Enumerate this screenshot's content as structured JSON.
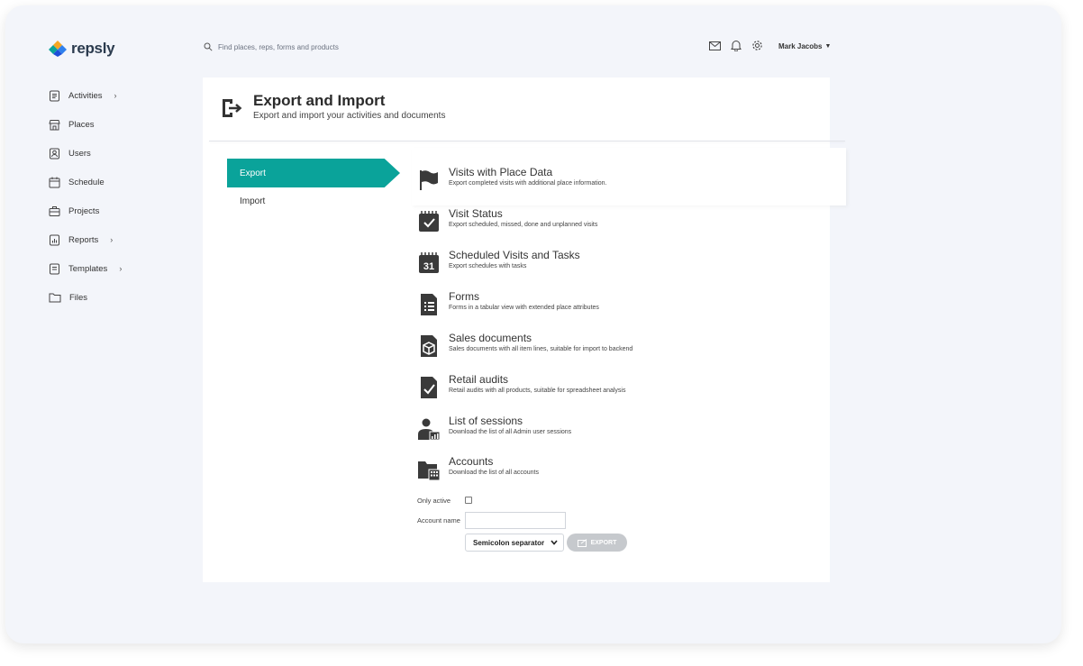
{
  "brand": {
    "name": "repsly"
  },
  "search": {
    "placeholder": "Find places, reps, forms and products"
  },
  "user": {
    "name": "Mark Jacobs"
  },
  "sidebar": {
    "items": [
      {
        "label": "Activities"
      },
      {
        "label": "Places"
      },
      {
        "label": "Users"
      },
      {
        "label": "Schedule"
      },
      {
        "label": "Projects"
      },
      {
        "label": "Reports"
      },
      {
        "label": "Templates"
      },
      {
        "label": "Files"
      }
    ]
  },
  "page": {
    "title": "Export and Import",
    "subtitle": "Export and import your activities and documents"
  },
  "tabs": {
    "export": "Export",
    "import": "Import"
  },
  "exports": [
    {
      "title": "Visits with Place Data",
      "desc": "Export completed visits with additional place information."
    },
    {
      "title": "Visit Status",
      "desc": "Export scheduled, missed, done and unplanned visits"
    },
    {
      "title": "Scheduled Visits and Tasks",
      "desc": "Export schedules with tasks"
    },
    {
      "title": "Forms",
      "desc": "Forms in a tabular view with extended place attributes"
    },
    {
      "title": "Sales documents",
      "desc": "Sales documents with all item lines, suitable for import to backend"
    },
    {
      "title": "Retail audits",
      "desc": "Retail audits with all products, suitable for spreadsheet analysis"
    },
    {
      "title": "List of sessions",
      "desc": "Download the list of all Admin user sessions"
    },
    {
      "title": "Accounts",
      "desc": "Download the list of all accounts"
    }
  ],
  "calendar_day": "31",
  "options": {
    "only_active_label": "Only active",
    "account_name_label": "Account name",
    "account_name_value": "",
    "separator_selected": "Semicolon separator",
    "export_button": "EXPORT"
  },
  "colors": {
    "accent": "#0aa39a",
    "icon_dark": "#3a3a3a",
    "button_disabled": "#c6c9cd"
  }
}
